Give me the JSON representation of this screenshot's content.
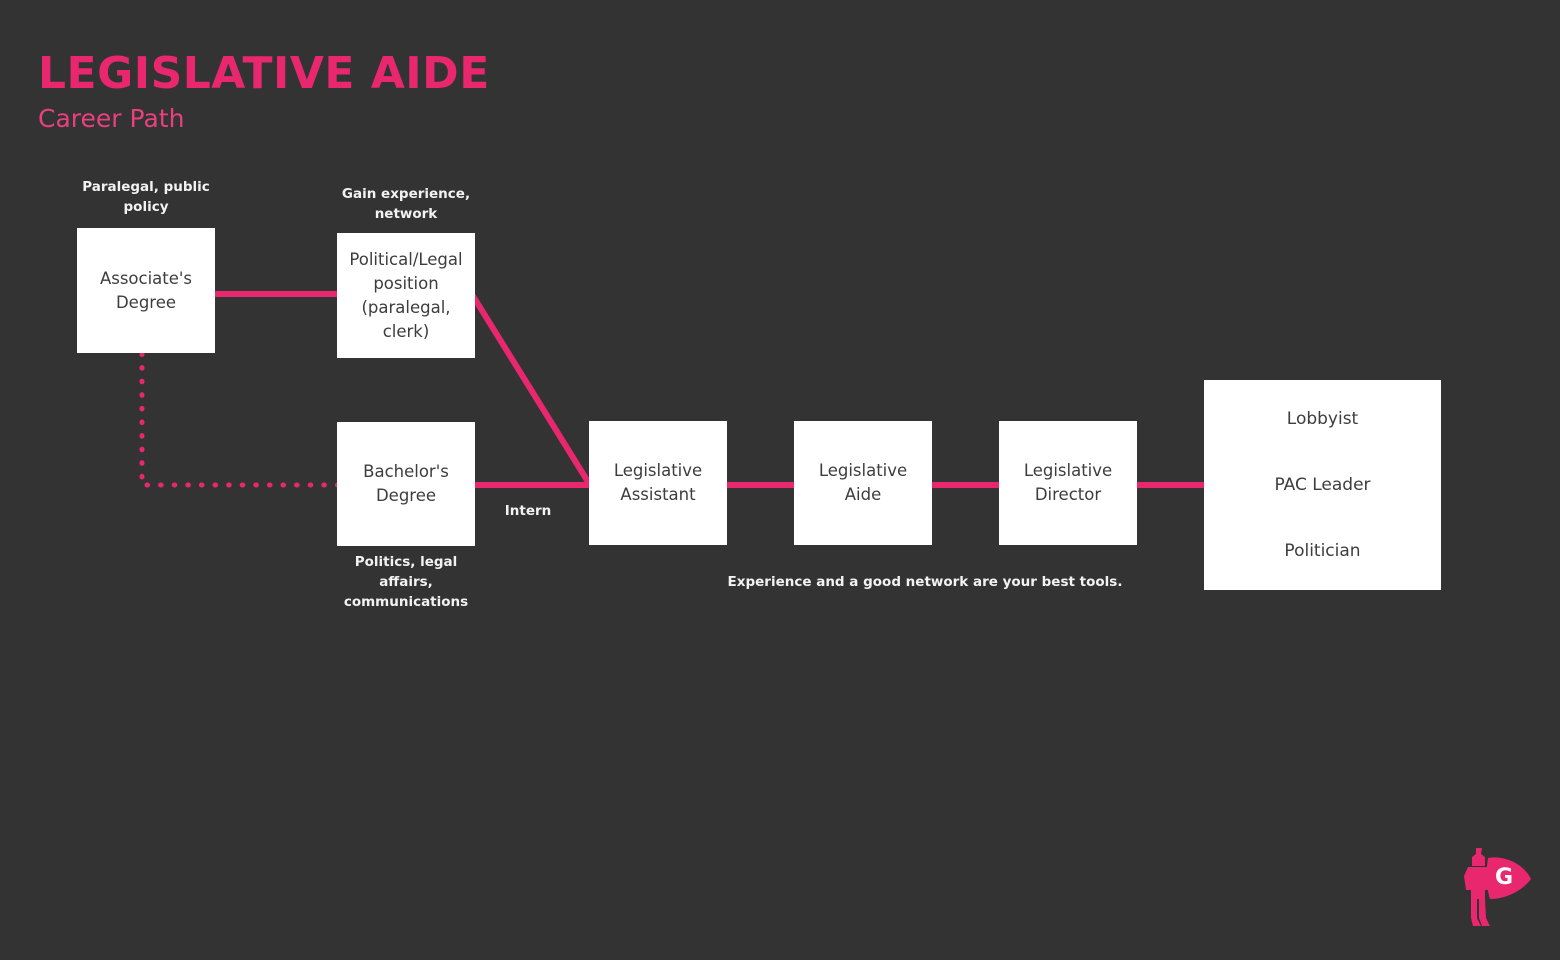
{
  "header": {
    "title": "LEGISLATIVE AIDE",
    "subtitle": "Career Path"
  },
  "colors": {
    "background": "#333333",
    "accent_pink": "#e8276e",
    "node_fill": "#ffffff",
    "node_text": "#3d3d3d",
    "annotation_text": "#f2f2f2"
  },
  "nodes": {
    "associates_degree": {
      "line1": "Associate's",
      "line2": "Degree"
    },
    "political_legal_position": {
      "line1": "Political/Legal",
      "line2": "position",
      "line3": "(paralegal,",
      "line4": "clerk)"
    },
    "bachelors_degree": {
      "line1": "Bachelor's",
      "line2": "Degree"
    },
    "legislative_assistant": {
      "line1": "Legislative",
      "line2": "Assistant"
    },
    "legislative_aide": {
      "line1": "Legislative",
      "line2": "Aide"
    },
    "legislative_director": {
      "line1": "Legislative",
      "line2": "Director"
    },
    "outcomes": {
      "line1": "Lobbyist",
      "line2": "PAC Leader",
      "line3": "Politician"
    }
  },
  "annotations": {
    "associates_note": {
      "line1": "Paralegal, public",
      "line2": "policy"
    },
    "political_note": {
      "line1": "Gain experience,",
      "line2": "network"
    },
    "bachelors_note": {
      "line1": "Politics, legal",
      "line2": "affairs,",
      "line3": "communications"
    },
    "intern_label": "Intern",
    "footer_note": "Experience and a good network are your best tools."
  },
  "logo": {
    "name": "superhero-g-logo",
    "letter": "G"
  }
}
